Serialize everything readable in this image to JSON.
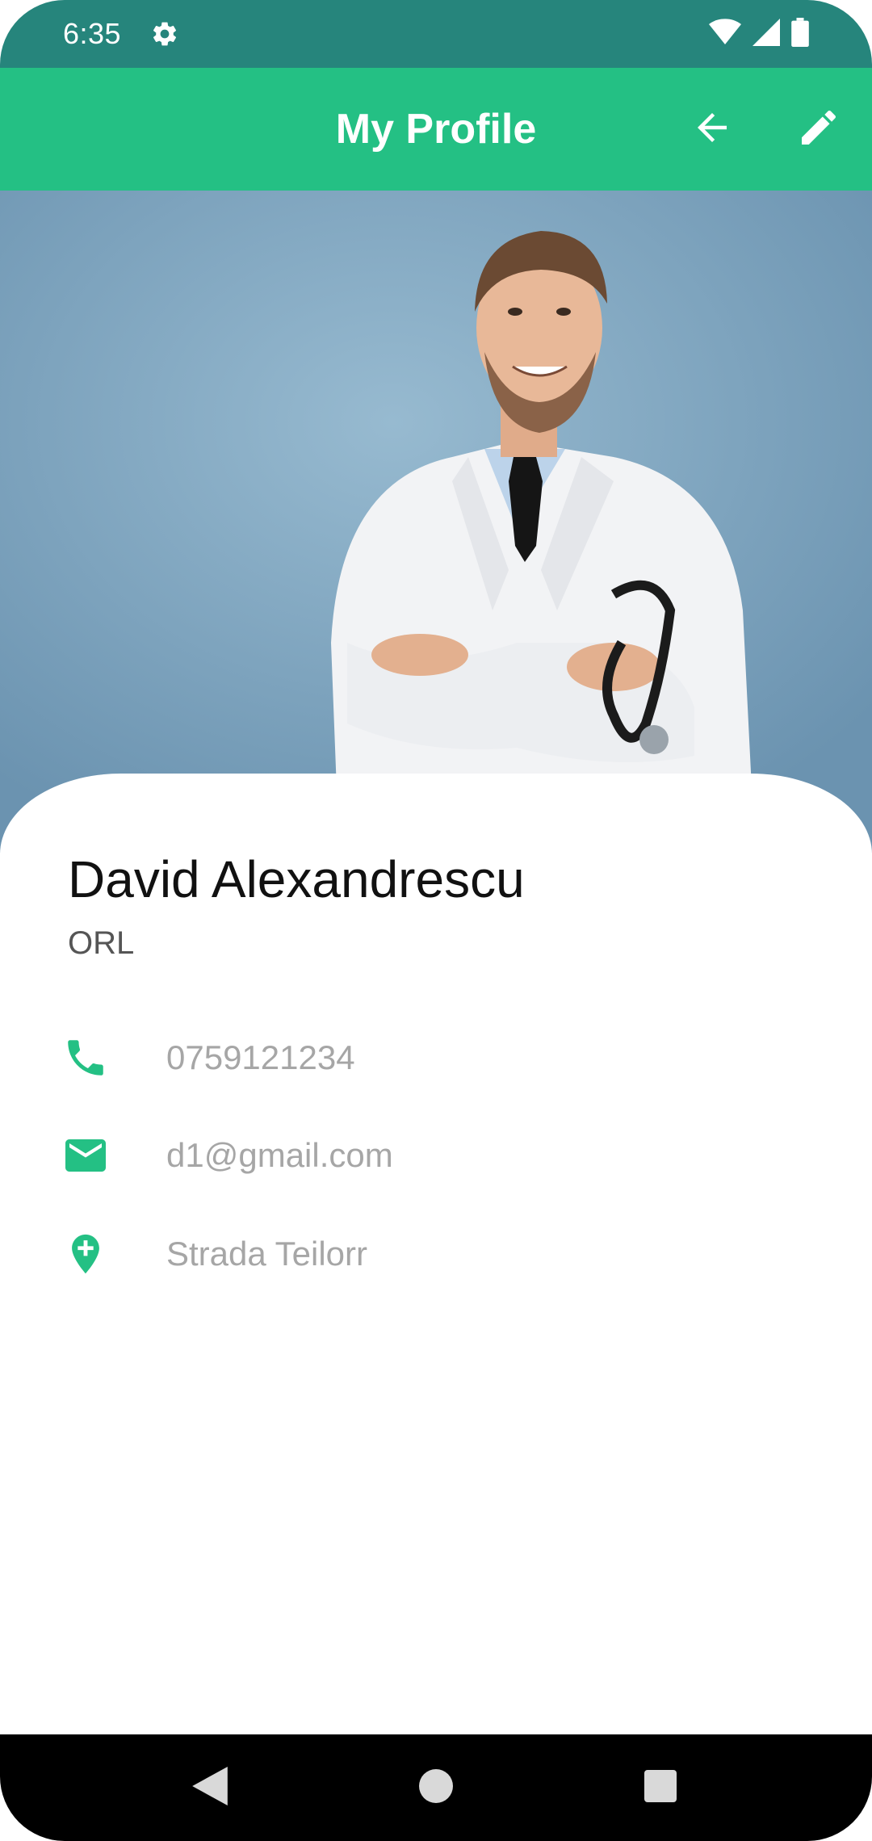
{
  "status_bar": {
    "time": "6:35",
    "icons": [
      "settings-icon",
      "wifi-icon",
      "cell-signal-icon",
      "battery-icon"
    ]
  },
  "toolbar": {
    "title": "My Profile",
    "back_icon": "arrow-left-icon",
    "edit_icon": "pencil-icon",
    "color": "#24c084"
  },
  "profile": {
    "name": "David Alexandrescu",
    "specialty": "ORL",
    "phone": "0759121234",
    "email": "d1@gmail.com",
    "address": "Strada Teilorr"
  },
  "colors": {
    "accent": "#24c084",
    "status_bar": "#26857c"
  },
  "nav_bar": {
    "icons": [
      "nav-back-icon",
      "nav-home-icon",
      "nav-recents-icon"
    ]
  }
}
